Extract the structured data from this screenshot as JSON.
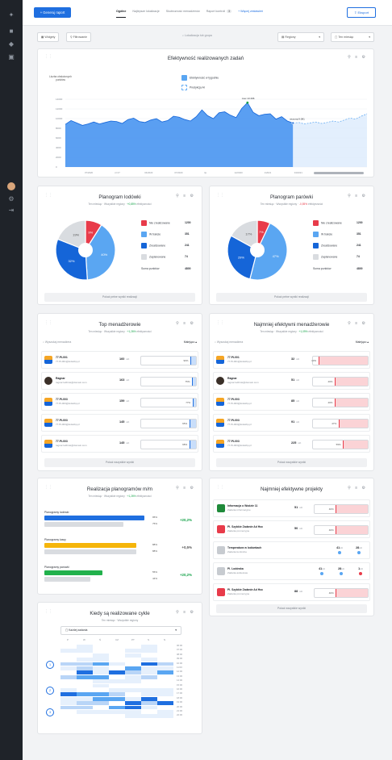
{
  "rail": {
    "icons": [
      "logo-icon",
      "home-icon",
      "dashboard-icon",
      "reports-icon"
    ],
    "bottom_icons": [
      "avatar",
      "settings-icon",
      "logout-icon"
    ]
  },
  "topbar": {
    "new_report": "+ Generuj raport",
    "tabs": [
      {
        "label": "Ogólne",
        "active": true
      },
      {
        "label": "Najlepsze lokalizacje",
        "active": false
      },
      {
        "label": "Skuteczność menadżerów",
        "active": false
      },
      {
        "label": "Raport kontroli",
        "active": false,
        "count": "3"
      }
    ],
    "more": "+ Więcej zestawień",
    "export": "Eksport"
  },
  "filters": {
    "widgets": "Widgety",
    "filter": "Filtrowanie",
    "location_placeholder": "Lokalizacja lub grupa",
    "regions": "Regiony",
    "period": "Ten miesiąc"
  },
  "effectiveness": {
    "title": "Efektywność realizowanych zadań",
    "ylabel": "Liczba obsłużonych punktów",
    "legend_real": "Efektywność w tygodniu",
    "legend_pred": "Predykcja AI",
    "max_label": "max 13 296",
    "current_label": "wczoraj 9.081",
    "xticks": [
      "07/2020",
      "cz 07",
      "04/2020",
      "07/2020",
      "lip",
      "12/2020",
      "1/2021",
      "04/2021",
      "09/2021",
      "12/2021"
    ],
    "yticks": [
      "14000",
      "12000",
      "10000",
      "8000",
      "6000",
      "4000",
      "2000",
      "0"
    ]
  },
  "chart_data": [
    {
      "type": "area",
      "title": "Efektywność realizowanych zadań",
      "ylabel": "Liczba obsłużonych punktów",
      "ylim": [
        0,
        14000
      ],
      "series": [
        {
          "name": "Efektywność w tygodniu",
          "values": [
            8800,
            9600,
            9100,
            8600,
            8900,
            9300,
            8900,
            9200,
            9500,
            9400,
            9000,
            9800,
            10100,
            9400,
            9200,
            9700,
            10000,
            9300,
            9600,
            10500,
            10300,
            9800,
            9500,
            10400,
            11800,
            10600,
            10000,
            11200,
            11400,
            10700,
            10200,
            12100,
            13296,
            11300,
            10600,
            10900,
            11000,
            9900,
            10400,
            9500,
            9081
          ]
        },
        {
          "name": "Predykcja AI",
          "values": [
            9081,
            9200,
            8900,
            9100,
            9300,
            9000,
            9200,
            9500,
            9300,
            9700,
            10100,
            9900,
            10500,
            11000
          ]
        }
      ]
    },
    {
      "type": "pie",
      "title": "Planogram lodówki",
      "values": [
        1200,
        351,
        241,
        74
      ],
      "labels": [
        "Nie zrealizowane",
        "W trakcie",
        "Zrealizowane",
        "Zaplanowane"
      ],
      "slice_labels": [
        "9%",
        "40%",
        "32%",
        "19%"
      ]
    },
    {
      "type": "pie",
      "title": "Planogram parówki",
      "values": [
        1200,
        351,
        241,
        74
      ],
      "labels": [
        "Nie zrealizowane",
        "W trakcie",
        "Zrealizowane",
        "Zaplanowane"
      ],
      "slice_labels": [
        "7%",
        "47%",
        "29%",
        "17%"
      ]
    },
    {
      "type": "heatmap",
      "title": "Kiedy są realizowane cykle"
    }
  ],
  "planogram_fridge": {
    "title": "Planogram lodówki",
    "sub_a": "Ten miesiąc",
    "sub_b": "Wszystkie regiony",
    "sub_delta": "+0,85%",
    "sub_c": "efektywności",
    "legend": [
      {
        "label": "Nie zrealizowane",
        "value": "1200",
        "color": "#e83b4a"
      },
      {
        "label": "W trakcie",
        "value": "351",
        "color": "#5aa6f2"
      },
      {
        "label": "Zrealizowane",
        "value": "241",
        "color": "#1565d8"
      },
      {
        "label": "Zaplanowane",
        "value": "74",
        "color": "#d9dce0"
      }
    ],
    "total_label": "Suma punktów",
    "total": "4800",
    "footer": "Pokaż pełne wyniki realizacji"
  },
  "planogram_sausage": {
    "title": "Planogram parówki",
    "sub_a": "Ten miesiąc",
    "sub_b": "Wszystkie regiony",
    "sub_delta": "-0,55%",
    "sub_c": "efektywności",
    "legend": [
      {
        "label": "Nie zrealizowane",
        "value": "1200",
        "color": "#e83b4a"
      },
      {
        "label": "W trakcie",
        "value": "351",
        "color": "#5aa6f2"
      },
      {
        "label": "Zrealizowane",
        "value": "241",
        "color": "#1565d8"
      },
      {
        "label": "Zaplanowane",
        "value": "74",
        "color": "#d9dce0"
      }
    ],
    "total_label": "Suma punktów",
    "total": "4800",
    "footer": "Pokaż pełne wyniki realizacji"
  },
  "top_managers": {
    "title": "Top menadżerowie",
    "sub_a": "Ten miesiąc",
    "sub_b": "Wszystkie regiony",
    "sub_delta": "+1,26%",
    "sub_c": "efektywności",
    "search": "Wyszukaj menadżera",
    "sort": "Malejąco ▴",
    "rows": [
      {
        "name": "77.PL001",
        "email": "77.PL001@lodekbp.pl",
        "value": "160",
        "unit": "szt",
        "pct": "90%",
        "fill": 0.1
      },
      {
        "name": "Ragnar",
        "email": "ragnar.lodbrok@domain.com",
        "value": "163",
        "unit": "szt",
        "pct": "75%",
        "fill": 0.07
      },
      {
        "name": "77.PL003",
        "email": "77.PL003@lodekbp.pl",
        "value": "159",
        "unit": "szt",
        "pct": "77%",
        "fill": 0.06
      },
      {
        "name": "77.PL003",
        "email": "77.PL003@lodekbp.pl",
        "value": "145",
        "unit": "szt",
        "pct": "65%",
        "fill": 0.12
      },
      {
        "name": "77.PL003",
        "email": "ragnar.lodbrok@domain.com",
        "value": "145",
        "unit": "szt",
        "pct": "68%",
        "fill": 0.12
      }
    ],
    "footer": "Pokaż wszystkie wyniki"
  },
  "worst_managers": {
    "title": "Najmniej efektywni menadżerowie",
    "sub_a": "Ten miesiąc",
    "sub_b": "Wszystkie regiony",
    "sub_delta": "+1,09%",
    "sub_c": "efektywności",
    "search": "Wyszukaj menadżera",
    "sort": "Malejąco ▴",
    "rows": [
      {
        "name": "77.PL001",
        "email": "77.PL001@lodekbp.pl",
        "value": "32",
        "unit": "szt",
        "pct": "10%",
        "fill": 0.9
      },
      {
        "name": "Ragnar",
        "email": "ragnar.lodbrok@domain.com",
        "value": "51",
        "unit": "szt",
        "pct": "40%",
        "fill": 0.6
      },
      {
        "name": "77.PL003",
        "email": "77.PL003@lodekbp.pl",
        "value": "85",
        "unit": "szt",
        "pct": "40%",
        "fill": 0.6
      },
      {
        "name": "77.PL003",
        "email": "77.PL003@lodekbp.pl",
        "value": "91",
        "unit": "szt",
        "pct": "47%",
        "fill": 0.53
      },
      {
        "name": "77.PL003",
        "email": "77.PL003@lodekbp.pl",
        "value": "225",
        "unit": "szt",
        "pct": "55%",
        "fill": 0.45
      }
    ],
    "footer": "Pokaż wszystkie wyniki"
  },
  "planogram_realization": {
    "title": "Realizacja planogramów m/m",
    "sub_a": "Ten miesiąc",
    "sub_b": "Wszystkie regiony",
    "sub_delta": "+1,26%",
    "sub_c": "efektywności",
    "items": [
      {
        "label": "Planogramy lodówki",
        "bar1": 0.95,
        "pct1": "95%",
        "bar2": 0.75,
        "pct2": "75%",
        "color": "#1f6fe0",
        "delta": "+20,2%",
        "delta_color": "#16a34a"
      },
      {
        "label": "Planogramy kawy",
        "bar1": 0.88,
        "pct1": "88%",
        "bar2": 0.88,
        "pct2": "88%",
        "color": "#f5b50a",
        "delta": "+0,5%",
        "delta_color": "#555555"
      },
      {
        "label": "Planogramy parówki",
        "bar1": 0.55,
        "pct1": "55%",
        "bar2": 0.44,
        "pct2": "44%",
        "color": "#22b14c",
        "delta": "+20,2%",
        "delta_color": "#16a34a"
      }
    ]
  },
  "worst_projects": {
    "title": "Najmniej efektywne projekty",
    "rows": [
      {
        "name": "Informacja o Wodzie 11",
        "sub": "Zadania informacyjne",
        "icon_color": "#1f8a3a",
        "type": "bar",
        "value": "51",
        "unit": "szt",
        "pct": "40%",
        "fill": 0.6
      },
      {
        "name": "Pl. Szybkie Zadanie Ad Hoc",
        "sub": "Zadania promocyjne",
        "icon_color": "#e83b4a",
        "type": "bar",
        "value": "50",
        "unit": "szt",
        "pct": "40%",
        "fill": 0.6
      },
      {
        "name": "Temperatura w lodówkach",
        "sub": "Zadania kontrolne",
        "icon_color": "#c7cbd0",
        "type": "mini",
        "mini": [
          {
            "v": "41",
            "u": "szt",
            "dot": "#5aa6f2"
          },
          {
            "v": "28",
            "u": "szt",
            "dot": "#5aa6f2"
          }
        ]
      },
      {
        "name": "Pl. Lodówka",
        "sub": "Zadania ankietowe",
        "icon_color": "#c7cbd0",
        "type": "mini",
        "mini": [
          {
            "v": "41",
            "u": "szt",
            "dot": "#5aa6f2"
          },
          {
            "v": "28",
            "u": "szt",
            "dot": "#5aa6f2"
          },
          {
            "v": "1",
            "u": "szt",
            "dot": "#e83b4a"
          }
        ]
      },
      {
        "name": "Pl. Szybkie Zadanie Ad Hoc",
        "sub": "Zadania promocyjne",
        "icon_color": "#e83b4a",
        "type": "bar",
        "value": "88",
        "unit": "szt",
        "pct": "40%",
        "fill": 0.6
      }
    ],
    "footer": "Pokaż wszystkie wyniki"
  },
  "cycles": {
    "title": "Kiedy są realizowane cykle",
    "sub_a": "Ten miesiąc",
    "sub_b": "Wszystkie regiony",
    "select": "Każdej zadania",
    "days": [
      "P",
      "W",
      "Ś",
      "CZ",
      "PT",
      "S",
      "N"
    ],
    "hours": [
      "06:00",
      "07:00",
      "08:00",
      "09:00",
      "10:00",
      "11:00",
      "12:00",
      "13:00",
      "14:00",
      "15:00",
      "16:00",
      "17:00",
      "18:00",
      "19:00",
      "20:00",
      "21:00",
      "22:00"
    ],
    "cycle_labels": [
      "1",
      "2",
      "3"
    ]
  }
}
